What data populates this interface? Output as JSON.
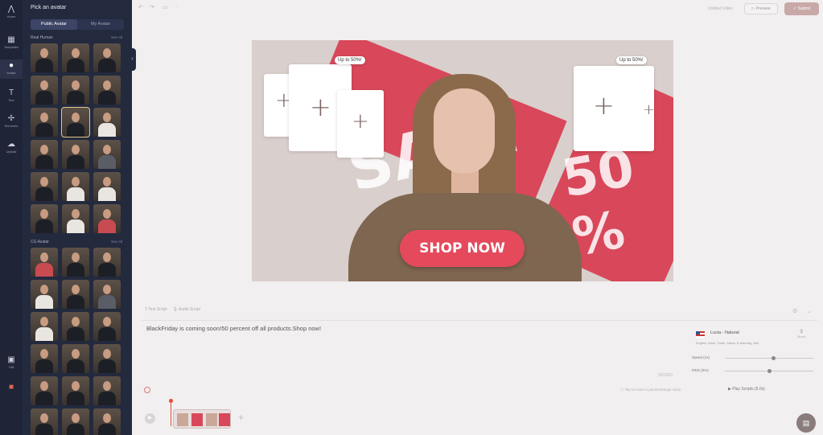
{
  "rail": {
    "items": [
      {
        "icon": "logo-icon",
        "label": "Home"
      },
      {
        "icon": "templates-icon",
        "label": "Templates"
      },
      {
        "icon": "avatar-icon",
        "label": "Avatar"
      },
      {
        "icon": "text-icon",
        "label": "Text"
      },
      {
        "icon": "elements-icon",
        "label": "Elements"
      },
      {
        "icon": "upload-icon",
        "label": "Upload"
      },
      {
        "icon": "gift-icon",
        "label": "Gift"
      },
      {
        "icon": "settings-icon",
        "label": ""
      }
    ]
  },
  "panel": {
    "title": "Pick an avatar",
    "tabs": [
      "Public Avatar",
      "My Avatar"
    ],
    "section1": {
      "title": "Real Human",
      "link": "See All"
    },
    "section2": {
      "title": "CG Avatar",
      "link": "See All"
    }
  },
  "toolbar": {
    "untitled": "Untitled Video",
    "preview": "Preview",
    "submit": "Submit"
  },
  "canvas": {
    "badge_left": "Up to 50%!",
    "badge_right": "Up to 50%!",
    "sale_text": "SALE",
    "percent_text": "50 %",
    "shop_now": "SHOP NOW"
  },
  "script": {
    "tab_text": "Text Script",
    "tab_audio": "Audio Script",
    "text": "BlackFriday is coming soon!50 percent off all products.Shop now!",
    "count": "59/1500",
    "hint": "Tap to insert a pause/change voice"
  },
  "voice": {
    "name": "Lucia - Natural",
    "sub": "English, Aries, Youth, News, E-learning, Ads",
    "num": "3",
    "num_label": "Mood",
    "speed_label": "Speed (1x)",
    "pitch_label": "Pitch (0%)",
    "speed_value": 0.55,
    "pitch_value": 0.5,
    "play_script": "Play Scripts (6.0s)"
  },
  "colors": {
    "accent": "#e44a5c",
    "sidebar": "#232a3e"
  }
}
